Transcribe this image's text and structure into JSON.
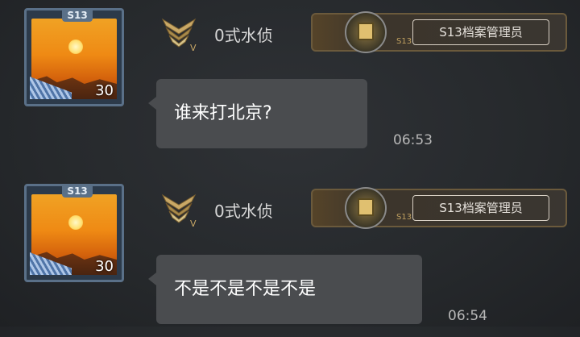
{
  "messages": [
    {
      "avatar": {
        "season_tag": "S13",
        "level": "30"
      },
      "sender": {
        "name": "0式水侦",
        "rank_icon": "rank-v-chevron-icon"
      },
      "title_badge": {
        "season": "S13",
        "label": "S13档案管理员",
        "icon": "archive-box-icon"
      },
      "text": "谁来打北京?",
      "time": "06:53"
    },
    {
      "avatar": {
        "season_tag": "S13",
        "level": "30"
      },
      "sender": {
        "name": "0式水侦",
        "rank_icon": "rank-v-chevron-icon"
      },
      "title_badge": {
        "season": "S13",
        "label": "S13档案管理员",
        "icon": "archive-box-icon"
      },
      "text": "不是不是不是不是",
      "time": "06:54"
    }
  ],
  "colors": {
    "bubble": "#4a4c4f",
    "text": "#ffffff",
    "time": "#b8b8b8",
    "background": "#26292c"
  }
}
